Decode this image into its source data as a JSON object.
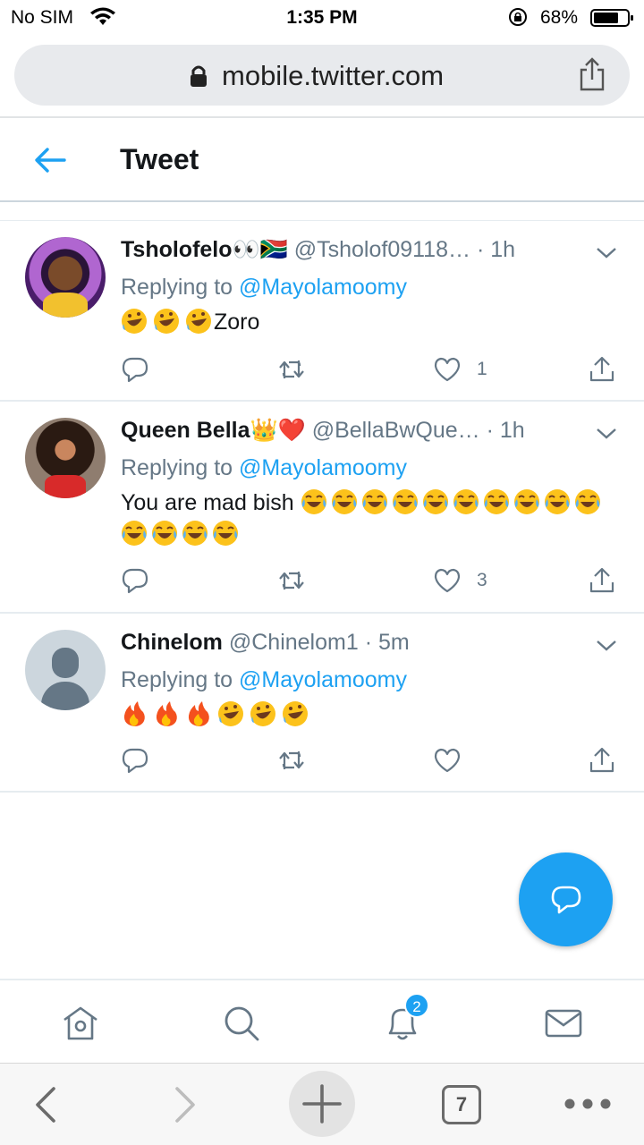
{
  "status_bar": {
    "carrier": "No SIM",
    "time": "1:35 PM",
    "battery": "68%"
  },
  "browser": {
    "url": "mobile.twitter.com",
    "tabs_count": "7"
  },
  "header": {
    "title": "Tweet"
  },
  "tweets": [
    {
      "name": "Tsholofelo👀🇿🇦",
      "handle": "@Tsholof09118…",
      "time": "· 1h",
      "replying_prefix": "Replying to ",
      "replying_to": "@Mayolamoomy",
      "text": "Zoro",
      "leading_emojis": [
        "rofl",
        "rofl",
        "rofl"
      ],
      "likes": "1"
    },
    {
      "name": "Queen Bella👑❤️",
      "handle": "@BellaBwQue…",
      "time": "· 1h",
      "replying_prefix": "Replying to ",
      "replying_to": "@Mayolamoomy",
      "text": "You are mad bish",
      "trailing_emojis": [
        "joy",
        "joy",
        "joy",
        "joy",
        "joy",
        "joy",
        "joy",
        "joy",
        "joy",
        "joy",
        "joy",
        "joy",
        "joy",
        "joy"
      ],
      "likes": "3"
    },
    {
      "name": "Chinelom",
      "handle": "@Chinelom1",
      "time": "· 5m",
      "replying_prefix": "Replying to ",
      "replying_to": "@Mayolamoomy",
      "text": "",
      "leading_emojis": [
        "fire",
        "fire",
        "fire",
        "rofl",
        "rofl",
        "rofl"
      ],
      "likes": ""
    }
  ],
  "tabbar": {
    "notifications_badge": "2"
  },
  "colors": {
    "accent": "#1da1f2",
    "muted": "#657786"
  }
}
